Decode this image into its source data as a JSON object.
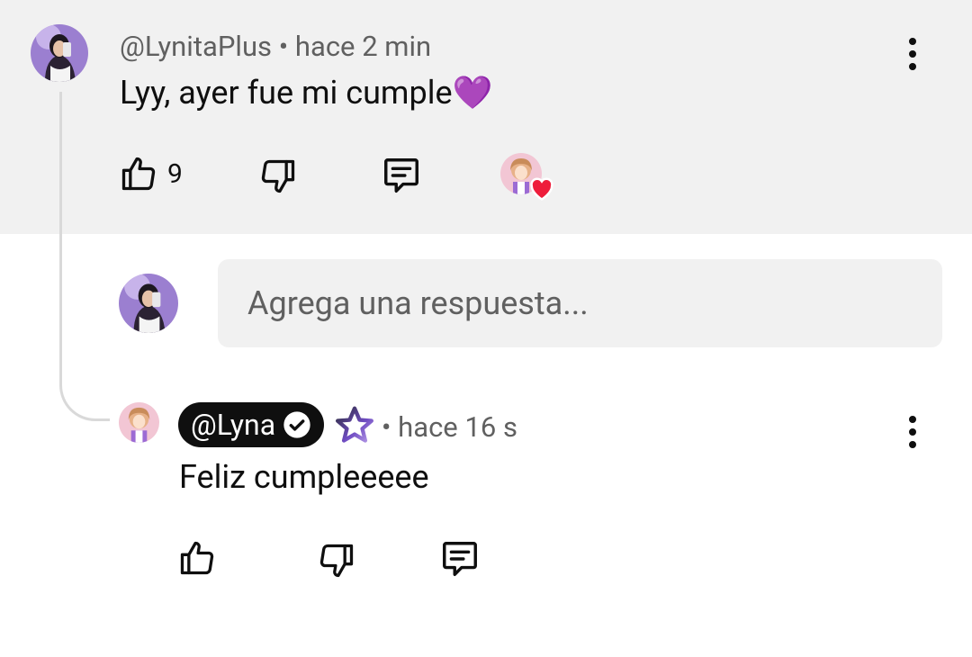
{
  "comment": {
    "author": "@LynitaPlus",
    "time": "• hace 2 min",
    "text": "Lyy, ayer fue mi cumple💜",
    "like_count": "9"
  },
  "reply_box": {
    "placeholder": "Agrega una respuesta..."
  },
  "reply": {
    "author": "@Lyna",
    "time": "• hace 16 s",
    "text": "Feliz cumpleeeee"
  },
  "icons": {
    "like": "thumbs-up-icon",
    "dislike": "thumbs-down-icon",
    "reply": "comment-icon",
    "more": "more-vertical-icon",
    "verified": "verified-check-icon",
    "star": "star-icon",
    "heart": "heart-icon"
  },
  "colors": {
    "highlight": "#f1f1f1",
    "heart": "#ee1d3b",
    "purple": "#8e44ad"
  }
}
